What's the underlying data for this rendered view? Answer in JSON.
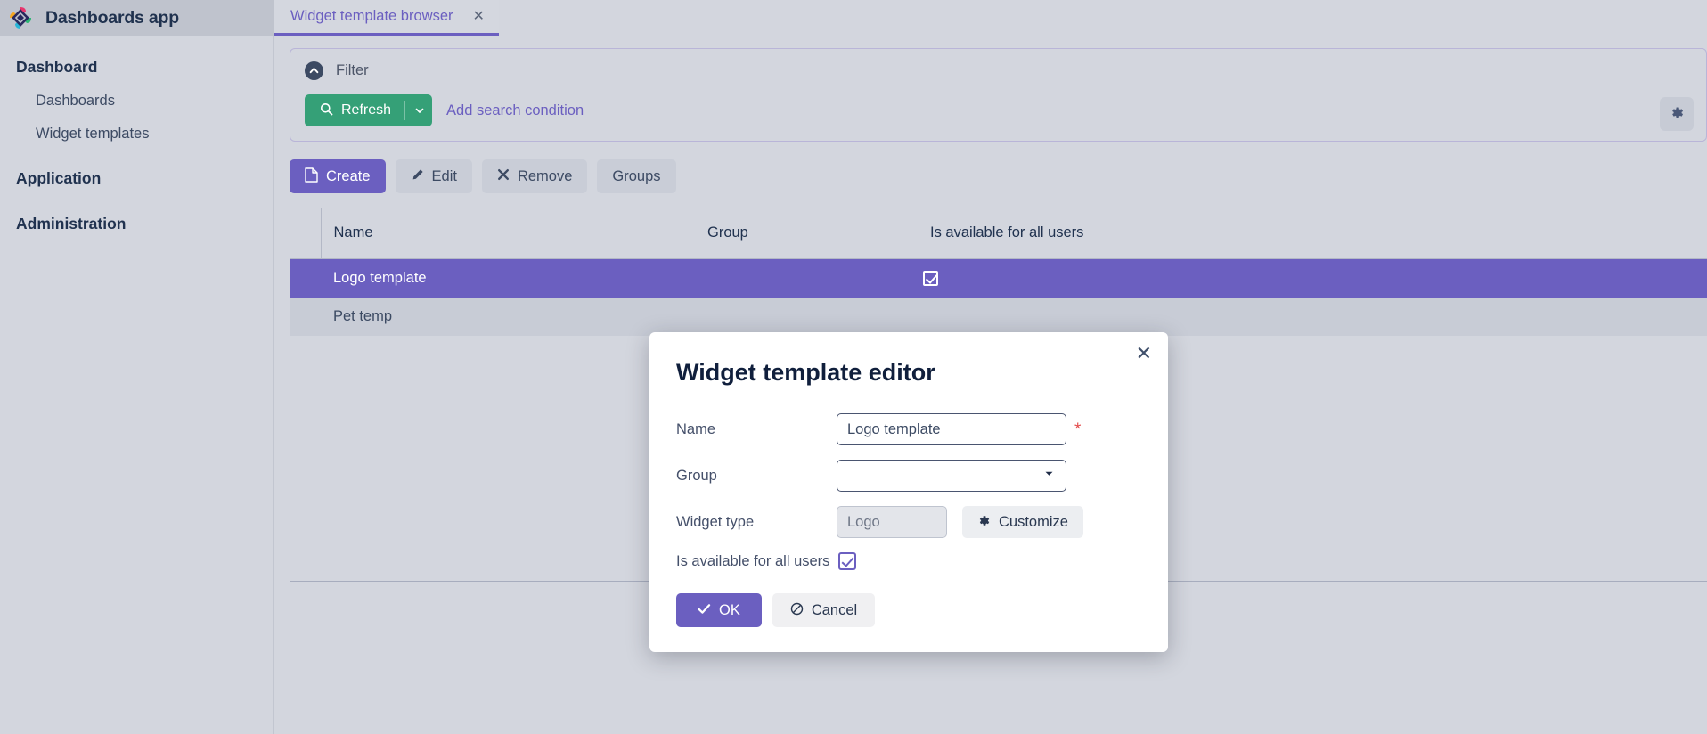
{
  "app": {
    "title": "Dashboards app",
    "logo_icon": "diamond-logo-icon",
    "accent_purple": "#6b5fc0",
    "accent_green": "#35a077",
    "required_red": "#e34b4b"
  },
  "tabs": [
    {
      "label": "Widget template browser",
      "close_icon": "close-icon",
      "active": true
    }
  ],
  "sidebar": {
    "groups": [
      {
        "title": "Dashboard",
        "items": [
          {
            "label": "Dashboards"
          },
          {
            "label": "Widget templates"
          }
        ]
      },
      {
        "title": "Application",
        "items": []
      },
      {
        "title": "Administration",
        "items": []
      }
    ]
  },
  "filter": {
    "collapse_icon": "chevron-up-icon",
    "label": "Filter",
    "refresh_label": "Refresh",
    "refresh_icon": "search-icon",
    "refresh_caret_icon": "chevron-down-icon",
    "add_condition_label": "Add search condition",
    "settings_icon": "gear-icon"
  },
  "toolbar": {
    "create_label": "Create",
    "create_icon": "file-icon",
    "edit_label": "Edit",
    "edit_icon": "pencil-icon",
    "remove_label": "Remove",
    "remove_icon": "cross-icon",
    "groups_label": "Groups"
  },
  "table": {
    "columns": [
      "Name",
      "Group",
      "Is available for all users"
    ],
    "rows": [
      {
        "name": "Logo template",
        "group": "",
        "available": true,
        "selected": true
      },
      {
        "name": "Pet temp",
        "group": "",
        "available": false,
        "selected": false
      }
    ]
  },
  "modal": {
    "title": "Widget template editor",
    "close_icon": "close-icon",
    "fields": {
      "name_label": "Name",
      "name_value": "Logo template",
      "name_placeholder": "",
      "name_required_marker": "*",
      "group_label": "Group",
      "group_value": "",
      "group_caret_icon": "chevron-down-icon",
      "widget_type_label": "Widget type",
      "widget_type_value": "Logo",
      "customize_label": "Customize",
      "customize_icon": "gear-icon",
      "available_label": "Is available for all users",
      "available_checked": true
    },
    "ok_label": "OK",
    "ok_icon": "check-icon",
    "cancel_label": "Cancel",
    "cancel_icon": "ban-icon"
  }
}
